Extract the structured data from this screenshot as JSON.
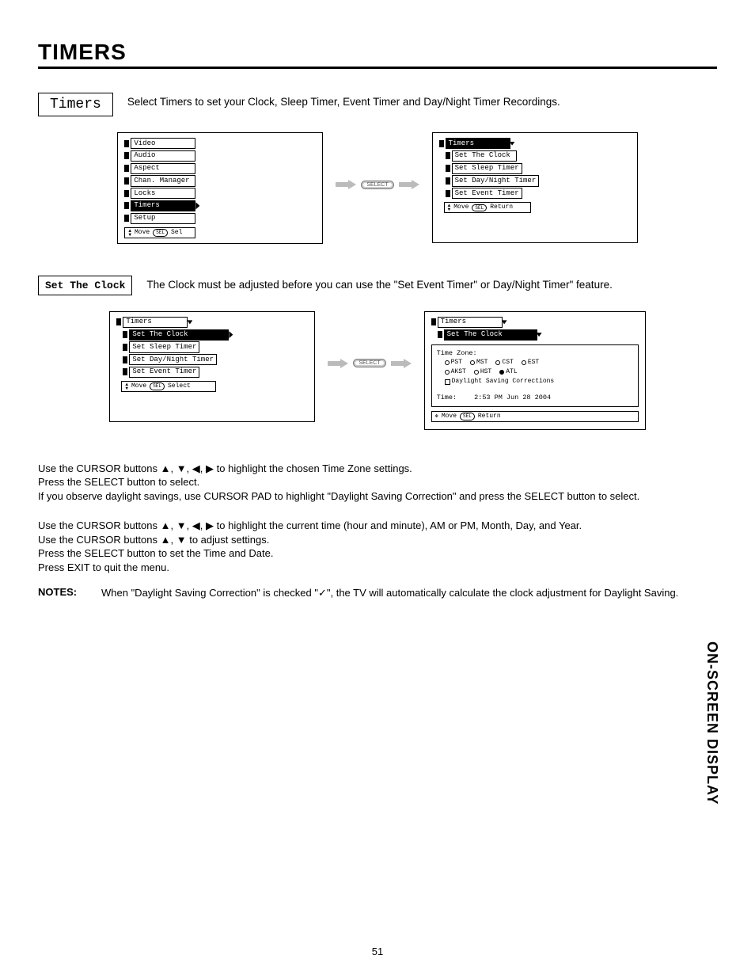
{
  "page": {
    "title": "TIMERS",
    "number": "51",
    "side_tab": "ON-SCREEN DISPLAY"
  },
  "section_timers": {
    "label": "Timers",
    "body": "Select Timers to set your Clock, Sleep Timer, Event Timer and Day/Night Timer Recordings."
  },
  "section_clock": {
    "label": "Set The Clock",
    "body": "The Clock must be adjusted before you can use the \"Set Event Timer\" or Day/Night Timer\" feature."
  },
  "main_menu": {
    "items": [
      "Video",
      "Audio",
      "Aspect",
      "Chan. Manager",
      "Locks",
      "Timers",
      "Setup"
    ],
    "active_index": 5,
    "help_move": "Move",
    "help_sel_pill": "SEL",
    "help_sel": "Sel"
  },
  "timers_menu": {
    "title": "Timers",
    "items": [
      "Set The Clock",
      "Set Sleep Timer",
      "Set Day/Night Timer",
      "Set Event Timer"
    ],
    "help_move": "Move",
    "help_sel_pill": "SEL",
    "help_return": "Return"
  },
  "timers_menu2": {
    "title": "Timers",
    "items": [
      "Set The Clock",
      "Set Sleep Timer",
      "Set Day/Night Timer",
      "Set Event Timer"
    ],
    "active_index": 0,
    "help_move": "Move",
    "help_sel_pill": "SEL",
    "help_select": "Select"
  },
  "clock_panel": {
    "crumb_timers": "Timers",
    "crumb_setclock": "Set The Clock",
    "tz_label": "Time Zone:",
    "tz_row1": [
      "PST",
      "MST",
      "CST",
      "EST"
    ],
    "tz_row2": [
      "AKST",
      "HST",
      "ATL"
    ],
    "tz_selected": "ATL",
    "daylight": "Daylight Saving Corrections",
    "time_label": "Time:",
    "time_value": "2:53 PM Jun 28 2004",
    "help_move": "Move",
    "help_sel_pill": "SEL",
    "help_return": "Return"
  },
  "flow": {
    "select_label": "SELECT"
  },
  "instructions1": {
    "l1a": "Use the CURSOR buttons ",
    "l1b": " to highlight the chosen Time Zone settings.",
    "arrows": "▲, ▼, ◀, ▶",
    "l2": "Press the SELECT button to select.",
    "l3": "If you observe daylight savings, use CURSOR PAD to highlight \"Daylight Saving Correction\" and press the SELECT button to select."
  },
  "instructions2": {
    "l1a": "Use the CURSOR buttons ",
    "l1b": " to highlight the current time (hour and minute), AM or PM, Month, Day, and Year.",
    "arrows4": "▲, ▼, ◀, ▶",
    "l2a": "Use the CURSOR buttons ",
    "l2b": " to adjust settings.",
    "arrows2": "▲, ▼",
    "l3": "Press the SELECT button to set the Time and Date.",
    "l4": "Press EXIT to quit the menu."
  },
  "notes": {
    "label": "NOTES:",
    "text_a": "When \"Daylight Saving Correction\" is checked \"",
    "check": "✓",
    "text_b": "\", the TV will automatically calculate the clock adjustment for Daylight Saving."
  }
}
